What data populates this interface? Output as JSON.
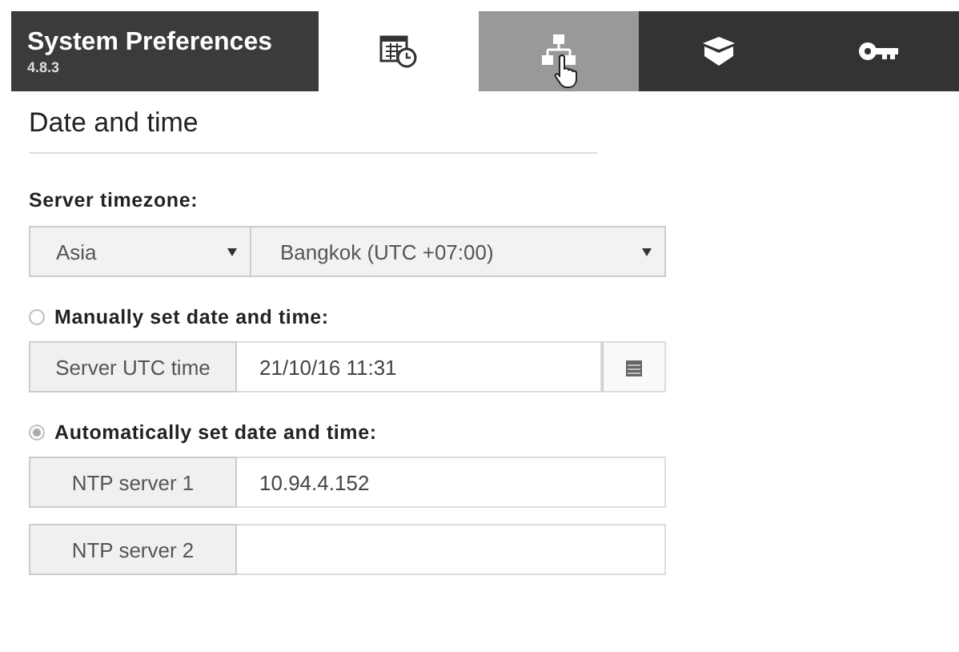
{
  "header": {
    "title": "System Preferences",
    "version": "4.8.3"
  },
  "tabs": [
    {
      "kind": "calendar",
      "selected": true,
      "hovered": false
    },
    {
      "kind": "network",
      "selected": false,
      "hovered": true
    },
    {
      "kind": "box",
      "selected": false,
      "hovered": false
    },
    {
      "kind": "key",
      "selected": false,
      "hovered": false
    }
  ],
  "section_title": "Date and time",
  "timezone": {
    "label": "Server timezone:",
    "region": "Asia",
    "city": "Bangkok (UTC +07:00)"
  },
  "modes": [
    {
      "label": "Manually set date and time:",
      "checked": false,
      "fields": [
        {
          "label": "Server UTC time",
          "value": "21/10/16 11:31",
          "calendar_button": true
        }
      ]
    },
    {
      "label": "Automatically set date and time:",
      "checked": true,
      "fields": [
        {
          "label": "NTP server 1",
          "value": "10.94.4.152",
          "calendar_button": false
        },
        {
          "label": "NTP server 2",
          "calendar_button": false
        }
      ]
    }
  ]
}
